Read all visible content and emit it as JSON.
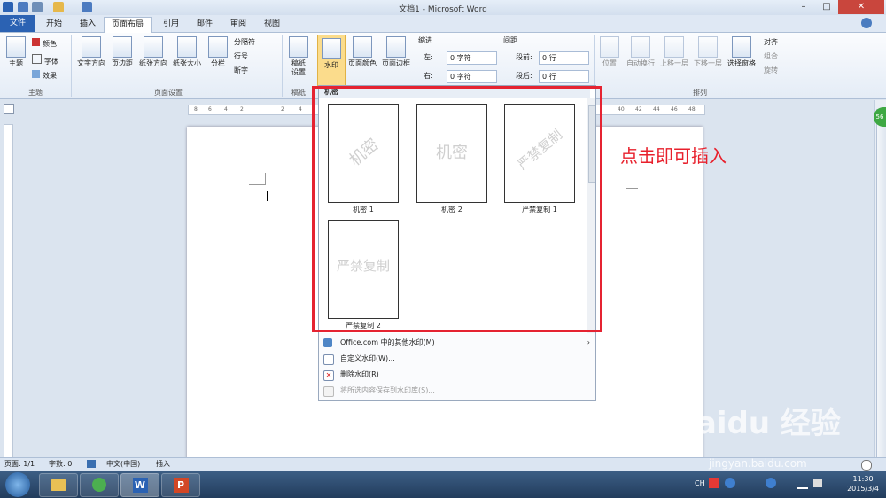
{
  "window": {
    "title": "文档1 - Microsoft Word"
  },
  "tabs": [
    "文件",
    "开始",
    "插入",
    "页面布局",
    "引用",
    "邮件",
    "审阅",
    "视图"
  ],
  "ribbon": {
    "theme_group": {
      "label": "主题",
      "theme_button": "主题",
      "colors": "颜色",
      "fonts": "字体",
      "effects": "效果"
    },
    "page_setup_group": {
      "label": "页面设置",
      "text_direction": "文字方向",
      "margins": "页边距",
      "orientation": "纸张方向",
      "size": "纸张大小",
      "columns": "分栏",
      "breaks": "分隔符",
      "line_numbers": "行号",
      "hyphenation": "断字"
    },
    "manuscript_group": {
      "label": "稿纸",
      "manuscript_settings": "稿纸\n设置"
    },
    "background_group": {
      "watermark": "水印",
      "page_color": "页面颜色",
      "page_borders": "页面边框"
    },
    "paragraph_group": {
      "indent_label": "缩进",
      "left_label": "左:",
      "left_value": "0 字符",
      "right_label": "右:",
      "right_value": "0 字符",
      "spacing_label": "间距",
      "before_label": "段前:",
      "before_value": "0 行",
      "after_label": "段后:",
      "after_value": "0 行"
    },
    "arrange_group": {
      "label": "排列",
      "position": "位置",
      "wrap_text": "自动换行",
      "bring_forward": "上移一层",
      "send_backward": "下移一层",
      "selection_pane": "选择窗格",
      "align": "对齐",
      "group": "组合",
      "rotate": "旋转"
    }
  },
  "watermark_gallery": {
    "category": "机密",
    "items": [
      {
        "label": "机密 1",
        "text": "机密"
      },
      {
        "label": "机密 2",
        "text": "机密"
      },
      {
        "label": "严禁复制 1",
        "text": "严禁复制"
      },
      {
        "label": "严禁复制 2",
        "text": "严禁复制"
      }
    ],
    "menu": [
      {
        "label": "Office.com 中的其他水印(M)",
        "disabled": false
      },
      {
        "label": "自定义水印(W)...",
        "disabled": false
      },
      {
        "label": "删除水印(R)",
        "disabled": false
      },
      {
        "label": "将所选内容保存到水印库(S)...",
        "disabled": true
      }
    ]
  },
  "annotation": "点击即可插入",
  "ruler": {
    "ticks": [
      "8",
      "6",
      "4",
      "2",
      "2",
      "4",
      "40",
      "42",
      "44",
      "46",
      "48"
    ]
  },
  "statusbar": {
    "page": "页面: 1/1",
    "words": "字数: 0",
    "language": "中文(中国)",
    "mode": "插入"
  },
  "taskbar": {
    "time": "11:30",
    "date": "2015/3/4",
    "ime": "CH"
  },
  "watermark_site": {
    "logo": "Baidu 经验",
    "url": "jingyan.baidu.com"
  },
  "colors": {
    "file_tab": "#2b62b3",
    "highlight": "#e52331",
    "accent": "#e8202c"
  }
}
